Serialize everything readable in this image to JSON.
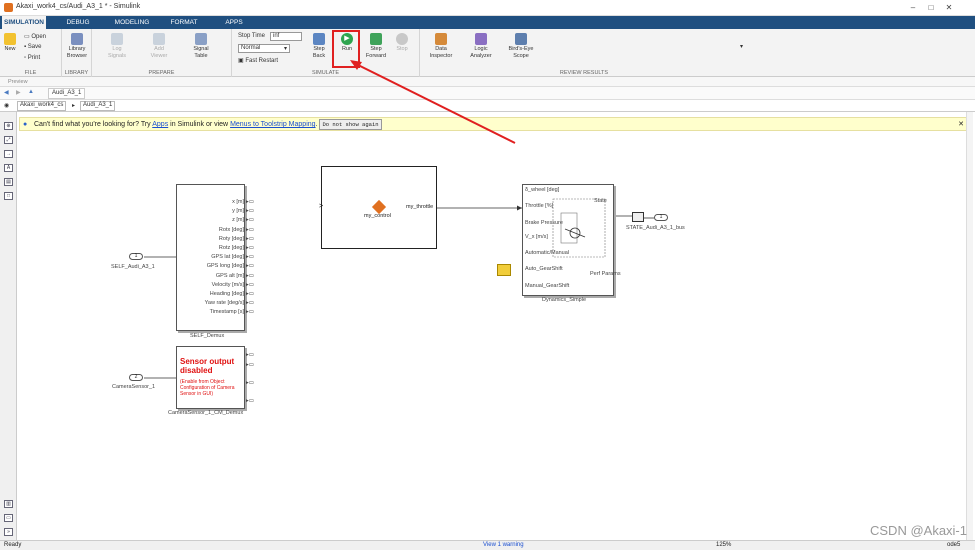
{
  "window": {
    "title": "Akaxi_work4_cs/Audi_A3_1 * - Simulink"
  },
  "tabs": [
    "SIMULATION",
    "DEBUG",
    "MODELING",
    "FORMAT",
    "APPS"
  ],
  "ribbon": {
    "file": {
      "new": "New",
      "open": "Open",
      "save": "Save",
      "print": "Print",
      "label": "FILE"
    },
    "library": {
      "browser": "Library Browser",
      "label": "LIBRARY"
    },
    "prepare": {
      "log": "Log Signals",
      "viewer": "Add Viewer",
      "signal_table": "Signal Table",
      "label": "PREPARE"
    },
    "simulate": {
      "stop_time_label": "Stop Time",
      "stop_time": "inf",
      "mode": "Normal",
      "fast_restart": "Fast Restart",
      "step_back": "Step Back",
      "run": "Run",
      "step_fwd": "Step Forward",
      "stop": "Stop",
      "label": "SIMULATE"
    },
    "review": {
      "inspector": "Data Inspector",
      "logic": "Logic Analyzer",
      "scope": "Bird's-Eye Scope",
      "label": "REVIEW RESULTS"
    }
  },
  "preview_label": "Preview",
  "nav": {
    "tab": "Audi_A3_1"
  },
  "breadcrumb": {
    "root": "Akaxi_work4_cs",
    "model": "Audi_A3_1"
  },
  "banner": {
    "prefix": "Can't find what you're looking for? Try ",
    "apps": "Apps",
    "middle": " in Simulink or view ",
    "menus": "Menus to Toolstrip Mapping",
    "end": ".",
    "dismiss": "Do not show again"
  },
  "model": {
    "self_inport": {
      "num": "1",
      "label": "SELF_Audi_A3_1"
    },
    "cam_inport": {
      "num": "2",
      "label": "CameraSensor_1"
    },
    "demux": {
      "ports": [
        "x [m]",
        "y [m]",
        "z [m]",
        "Rotx [deg]",
        "Roty [deg]",
        "Rotz [deg]",
        "GPS lat [deg]",
        "GPS long [deg]",
        "GPS alt [m]",
        "Velocity [m/s]",
        "Heading [deg]",
        "Yaw rate [deg/s]",
        "Timestamp [s]"
      ],
      "caption": "SELF_Demux"
    },
    "sensor": {
      "title": "Sensor output disabled",
      "note": "(Enable from Object Configuration of Camera Sensor in GUI)",
      "caption": "CameraSensor_1_CM_Demux"
    },
    "control": {
      "name": "my_control",
      "out": "my_throttle"
    },
    "dyn": {
      "ports": [
        "δ_wheel [deg]",
        "Throttle [%]",
        "Brake Pressure",
        "V_x [m/s]",
        "Automatic/Manual",
        "Auto_GearShift",
        "Manual_GearShift"
      ],
      "state": "State",
      "perf": "Perf Params",
      "caption": "Dynamics_Simple"
    },
    "outport": {
      "num": "1",
      "label": "STATE_Audi_A3_1_bus"
    }
  },
  "status": {
    "left": "Ready",
    "warn": "View 1 warning",
    "zoom": "125%",
    "solver": "ode5"
  },
  "watermark": "CSDN @Akaxi-1"
}
